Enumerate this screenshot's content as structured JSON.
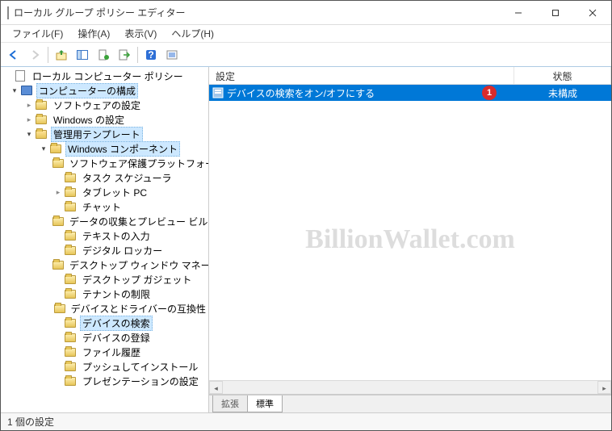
{
  "window": {
    "title": "ローカル グループ ポリシー エディター"
  },
  "menu": {
    "file": "ファイル(F)",
    "action": "操作(A)",
    "view": "表示(V)",
    "help": "ヘルプ(H)"
  },
  "tree": {
    "root": "ローカル コンピューター ポリシー",
    "computer_config": "コンピューターの構成",
    "software_settings": "ソフトウェアの設定",
    "windows_settings": "Windows の設定",
    "admin_templates": "管理用テンプレート",
    "windows_components": "Windows コンポーネント",
    "items": [
      "ソフトウェア保護プラットフォーム",
      "タスク スケジューラ",
      "タブレット PC",
      "チャット",
      "データの収集とプレビュー ビル",
      "テキストの入力",
      "デジタル ロッカー",
      "デスクトップ ウィンドウ マネージ",
      "デスクトップ ガジェット",
      "テナントの制限",
      "デバイスとドライバーの互換性",
      "デバイスの検索",
      "デバイスの登録",
      "ファイル履歴",
      "プッシュしてインストール",
      "プレゼンテーションの設定"
    ],
    "selected_index": 11
  },
  "list": {
    "header_setting": "設定",
    "header_state": "状態",
    "row": {
      "setting": "デバイスの検索をオン/オフにする",
      "state": "未構成"
    }
  },
  "annotation": {
    "badge": "1"
  },
  "tabs": {
    "extended": "拡張",
    "standard": "標準"
  },
  "status": {
    "text": "1 個の設定"
  },
  "watermark": "BillionWallet.com"
}
